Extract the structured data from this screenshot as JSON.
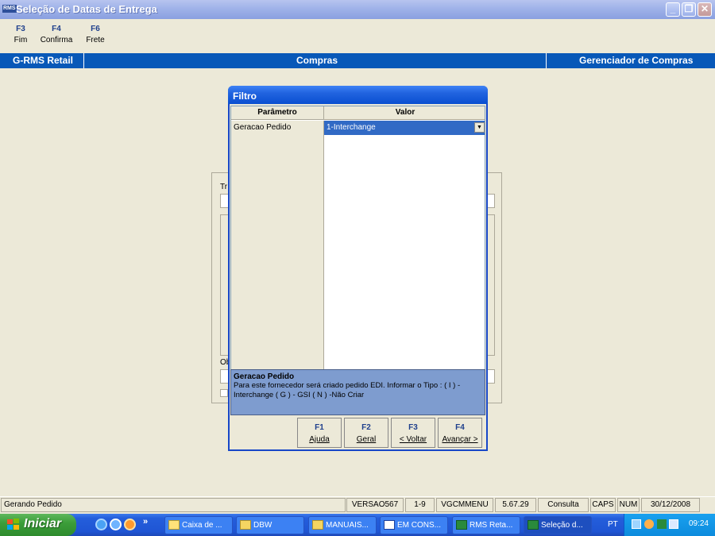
{
  "window": {
    "title": "Seleção de Datas de Entrega",
    "app_badge": "RMS"
  },
  "fkeys": [
    {
      "key": "F3",
      "label": "Fim"
    },
    {
      "key": "F4",
      "label": "Confirma"
    },
    {
      "key": "F6",
      "label": "Frete"
    }
  ],
  "band": {
    "left": "G-RMS Retail",
    "center": "Compras",
    "right": "Gerenciador de Compras"
  },
  "background_form": {
    "label_tr": "Tr",
    "label_ob": "Ob"
  },
  "dialog": {
    "title": "Filtro",
    "col_param": "Parâmetro",
    "col_value": "Valor",
    "rows": [
      {
        "param": "Geracao Pedido",
        "value": "1-Interchange"
      }
    ],
    "desc_title": "Geracao Pedido",
    "desc_text": "Para este fornecedor será criado pedido EDI. Informar o Tipo : ( I ) - Interchange ( G ) - GSI ( N ) -Não Criar",
    "buttons": [
      {
        "key": "F1",
        "label": "Ajuda"
      },
      {
        "key": "F2",
        "label": "Geral"
      },
      {
        "key": "F3",
        "label": "< Voltar"
      },
      {
        "key": "F4",
        "label": "Avançar >"
      }
    ]
  },
  "statusbar": {
    "message": "Gerando Pedido",
    "version": "VERSAO567",
    "range": "1-9",
    "menu": "VGCMMENU",
    "build": "5.67.29",
    "mode": "Consulta",
    "caps": "CAPS",
    "num": "NUM",
    "date": "30/12/2008"
  },
  "taskbar": {
    "start_label": "Iniciar",
    "chevron": "»",
    "tasks": [
      {
        "label": "Caixa de ..."
      },
      {
        "label": "DBW"
      },
      {
        "label": "MANUAIS..."
      },
      {
        "label": "EM CONS..."
      },
      {
        "label": "RMS Reta..."
      },
      {
        "label": "Seleção d..."
      }
    ],
    "lang": "PT",
    "clock": "09:24"
  }
}
